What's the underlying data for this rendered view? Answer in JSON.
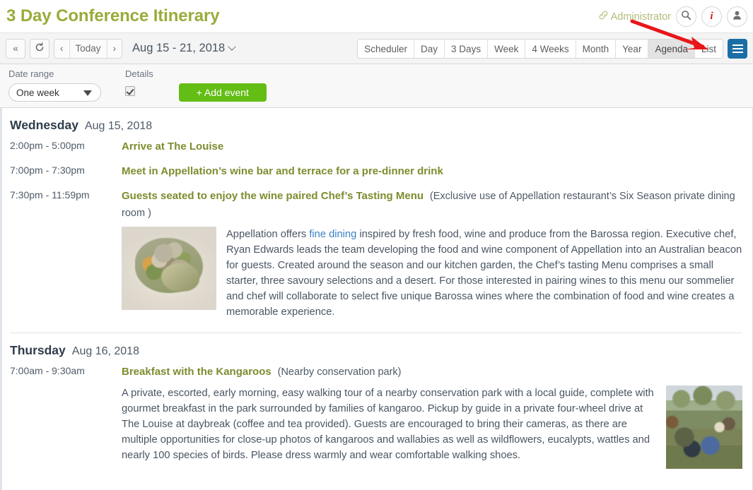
{
  "header": {
    "title": "3 Day Conference Itinerary",
    "admin_label": "Administrator",
    "link_icon": "link-icon",
    "search_icon": "search-icon",
    "info_icon": "info-icon",
    "user_icon": "user-avatar-icon",
    "title_color": "#9aab3a"
  },
  "toolbar": {
    "collapse_label": "«",
    "refresh_label": "⟳",
    "prev_label": "‹",
    "today_label": "Today",
    "next_label": "›",
    "date_range": "Aug 15 - 21, 2018",
    "view_tabs": [
      {
        "label": "Scheduler",
        "active": false
      },
      {
        "label": "Day",
        "active": false
      },
      {
        "label": "3 Days",
        "active": false
      },
      {
        "label": "Week",
        "active": false
      },
      {
        "label": "4 Weeks",
        "active": false
      },
      {
        "label": "Month",
        "active": false
      },
      {
        "label": "Year",
        "active": false
      },
      {
        "label": "Agenda",
        "active": true
      },
      {
        "label": "List",
        "active": false
      }
    ],
    "menu_icon": "hamburger-menu-icon",
    "menu_color": "#1b6ea5"
  },
  "controls": {
    "date_range_label": "Date range",
    "date_range_value": "One week",
    "details_label": "Details",
    "details_checked": true,
    "add_event_label": "+ Add event",
    "add_event_color": "#63bd14"
  },
  "agenda": {
    "days": [
      {
        "day_name": "Wednesday",
        "day_date": "Aug 15, 2018",
        "events": [
          {
            "time": "2:00pm - 5:00pm",
            "title": "Arrive at The Louise",
            "sub": "",
            "description": "",
            "image": "none",
            "image_side": "none"
          },
          {
            "time": "7:00pm - 7:30pm",
            "title": "Meet in Appellation’s wine bar and terrace for a pre-dinner drink",
            "sub": "",
            "description": "",
            "image": "none",
            "image_side": "none"
          },
          {
            "time": "7:30pm - 11:59pm",
            "title": "Guests seated to enjoy the wine paired Chef’s Tasting Menu",
            "sub": "(Exclusive use of Appellation restaurant’s Six Season private dining room )",
            "description_pre": "Appellation offers ",
            "description_link": "fine dining",
            "description_post": " inspired by fresh food, wine and produce from the Barossa region. Executive chef, Ryan Edwards leads the team developing the food and wine component of Appellation into an Australian beacon for guests. Created around the season and our kitchen garden, the Chef’s tasting Menu comprises a small starter, three savoury selections and a desert. For those interested in pairing wines to this menu our sommelier and chef will collaborate to select five unique Barossa wines where the combination of food and wine creates a memorable experience.",
            "image": "plated-dish-photo",
            "image_side": "left"
          }
        ]
      },
      {
        "day_name": "Thursday",
        "day_date": "Aug 16, 2018",
        "events": [
          {
            "time": "7:00am - 9:30am",
            "title": "Breakfast with the Kangaroos",
            "sub": "(Nearby conservation park)",
            "description": "A private, escorted, early morning, easy walking tour of a nearby conservation park with a local guide, complete with gourmet breakfast in the park surrounded by families of kangaroo. Pickup by guide in a private four-wheel drive at The Louise at daybreak (coffee and tea provided). Guests are encouraged to bring their cameras, as there are multiple opportunities for close-up photos of kangaroos and wallabies as well as wildflowers, eucalypts, wattles and nearly 100 species of birds. Please dress warmly and wear comfortable walking shoes.",
            "image": "picnic-kangaroo-photo",
            "image_side": "right"
          }
        ]
      }
    ]
  },
  "annotation": {
    "arrow": "red-arrow-pointing-to-agenda-tab",
    "color": "#e8161a"
  }
}
